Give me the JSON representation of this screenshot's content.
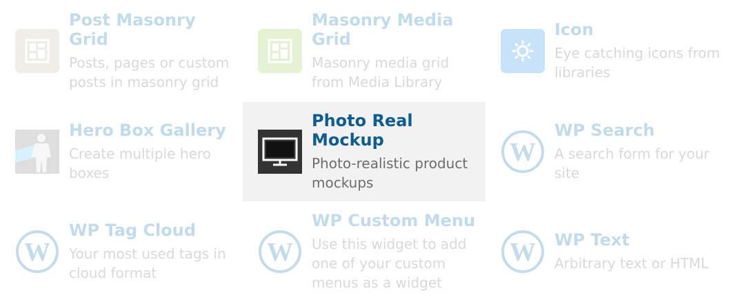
{
  "widgets": [
    {
      "title": "Post Masonry Grid",
      "description": "Posts, pages or custom posts in masonry grid",
      "icon": "masonry-grid-icon",
      "icon_bg": "#c9c1ae",
      "state": "dim"
    },
    {
      "title": "Masonry Media Grid",
      "description": "Masonry media grid from Media Library",
      "icon": "media-grid-icon",
      "icon_bg": "#9fd264",
      "state": "dim"
    },
    {
      "title": "Icon",
      "description": "Eye catching icons from libraries",
      "icon": "gear-icon",
      "icon_bg": "#3d98f0",
      "state": "dim"
    },
    {
      "title": "Hero Box Gallery",
      "description": "Create multiple hero boxes",
      "icon": "hero-figure-icon",
      "icon_bg": "#8c8c8c",
      "state": "dim"
    },
    {
      "title": "Photo Real Mockup",
      "description": "Photo-realistic product mockups",
      "icon": "monitor-icon",
      "icon_bg": "#333333",
      "state": "active"
    },
    {
      "title": "WP Search",
      "description": "A search form for your site",
      "icon": "wordpress-icon",
      "icon_bg": "#2a7fb8",
      "state": "dim"
    },
    {
      "title": "WP Tag Cloud",
      "description": "Your most used tags in cloud format",
      "icon": "wordpress-icon",
      "icon_bg": "#2a7fb8",
      "state": "dim"
    },
    {
      "title": "WP Custom Menu",
      "description": "Use this widget to add one of your custom menus as a widget",
      "icon": "wordpress-icon",
      "icon_bg": "#2a7fb8",
      "state": "dim"
    },
    {
      "title": "WP Text",
      "description": "Arbitrary text or HTML",
      "icon": "wordpress-icon",
      "icon_bg": "#2a7fb8",
      "state": "dim"
    }
  ]
}
